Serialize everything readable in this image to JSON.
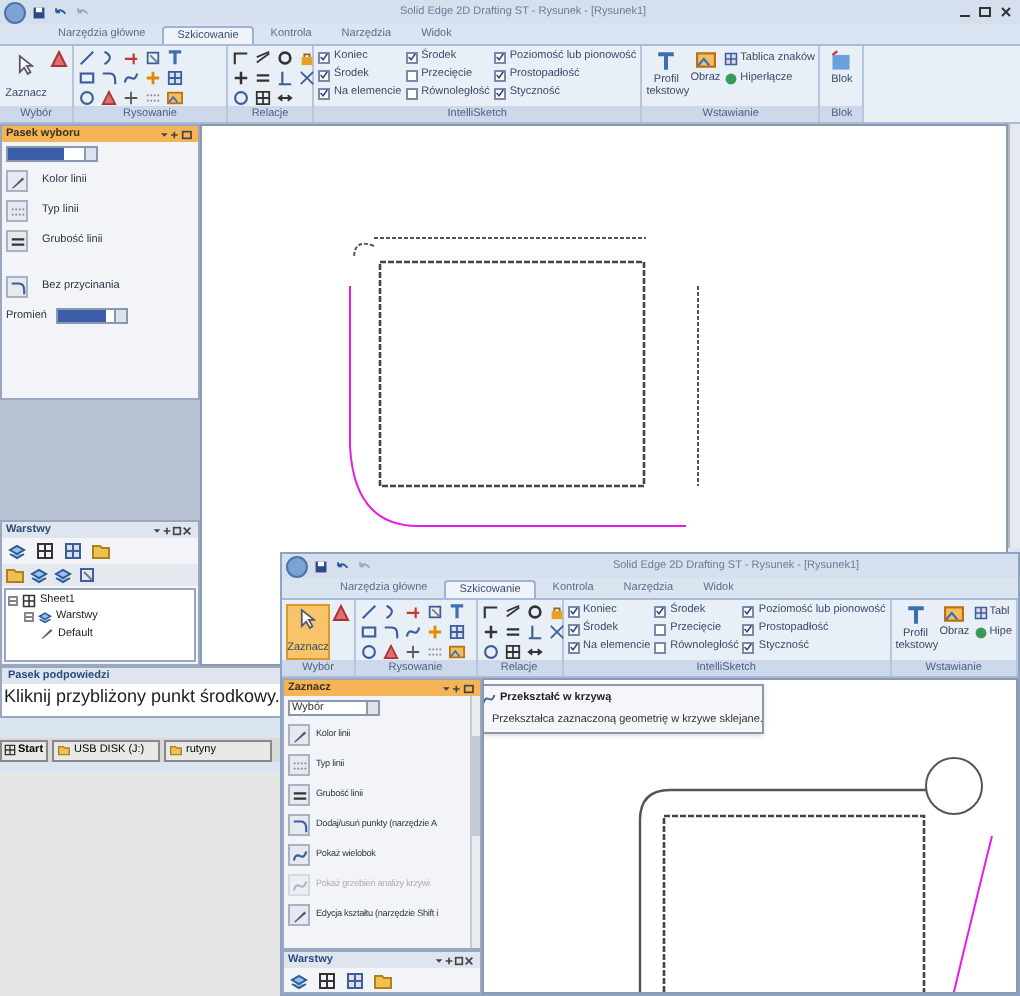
{
  "windows": [
    {
      "title": "Solid Edge 2D Drafting ST - Rysunek - [Rysunek1]",
      "tabs": [
        {
          "label": "Narzędzia główne",
          "selected": false
        },
        {
          "label": "Szkicowanie",
          "selected": true
        },
        {
          "label": "Kontrola",
          "selected": false
        },
        {
          "label": "Narzędzia",
          "selected": false
        },
        {
          "label": "Widok",
          "selected": false
        }
      ],
      "select_tool": {
        "label": "Zaznacz",
        "active": false
      },
      "group_labels": [
        "Wybór",
        "Rysowanie",
        "Relacje",
        "IntelliSketch",
        "Wstawianie",
        "Blok"
      ],
      "intellisketch": [
        {
          "label": "Koniec",
          "checked": true
        },
        {
          "label": "Środek",
          "checked": true
        },
        {
          "label": "Na elemencie",
          "checked": true
        },
        {
          "label": "Środek",
          "checked": true
        },
        {
          "label": "Przecięcie",
          "checked": false
        },
        {
          "label": "Równoległość",
          "checked": false
        },
        {
          "label": "Poziomość lub pionowość",
          "checked": true
        },
        {
          "label": "Prostopadłość",
          "checked": true
        },
        {
          "label": "Styczność",
          "checked": true
        }
      ],
      "insert_tools": [
        "Profil tekstowy",
        "Obraz",
        "Tablica znaków",
        "Hiperłącze"
      ],
      "block_tool": "Blok",
      "panel": {
        "title": "Pasek wyboru",
        "items": [
          {
            "label": "Kolor linii",
            "disabled": false
          },
          {
            "label": "Typ linii",
            "disabled": false
          },
          {
            "label": "Grubość linii",
            "disabled": false
          },
          {
            "label": "Bez przycinania",
            "disabled": false
          }
        ],
        "field_label": "Promień"
      },
      "layers_panel": {
        "title": "Warstwy",
        "tree": [
          {
            "label": "Sheet1",
            "expanded": true,
            "children": [
              {
                "label": "Warstwy",
                "expanded": true,
                "children": [
                  {
                    "label": "Default"
                  }
                ]
              }
            ]
          }
        ]
      },
      "hint_bar": {
        "title": "Pasek podpowiedzi",
        "text": "Kliknij przybliżony punkt środkowy."
      },
      "taskbar": {
        "start": "Start",
        "items": [
          "USB DISK (J:)",
          "rutyny"
        ]
      }
    },
    {
      "title": "Solid Edge 2D Drafting ST - Rysunek - [Rysunek1]",
      "tabs": [
        {
          "label": "Narzędzia główne",
          "selected": false
        },
        {
          "label": "Szkicowanie",
          "selected": true
        },
        {
          "label": "Kontrola",
          "selected": false
        },
        {
          "label": "Narzędzia",
          "selected": false
        },
        {
          "label": "Widok",
          "selected": false
        }
      ],
      "select_tool": {
        "label": "Zaznacz",
        "active": true
      },
      "group_labels": [
        "Wybór",
        "Rysowanie",
        "Relacje",
        "IntelliSketch",
        "Wstawianie"
      ],
      "intellisketch": [
        {
          "label": "Koniec",
          "checked": true
        },
        {
          "label": "Środek",
          "checked": true
        },
        {
          "label": "Na elemencie",
          "checked": true
        },
        {
          "label": "Środek",
          "checked": true
        },
        {
          "label": "Przecięcie",
          "checked": false
        },
        {
          "label": "Równoległość",
          "checked": false
        },
        {
          "label": "Poziomość lub pionowość",
          "checked": true
        },
        {
          "label": "Prostopadłość",
          "checked": true
        },
        {
          "label": "Styczność",
          "checked": true
        }
      ],
      "insert_tools": [
        "Profil tekstowy",
        "Obraz",
        "Tabl",
        "Hipe"
      ],
      "panel": {
        "title": "Zaznacz",
        "dropdown": "Wybór",
        "items": [
          {
            "label": "Kolor linii",
            "disabled": false
          },
          {
            "label": "Typ linii",
            "disabled": false
          },
          {
            "label": "Grubość linii",
            "disabled": false
          },
          {
            "label": "Dodaj/usuń punkty (narzędzie A",
            "disabled": false
          },
          {
            "label": "Pokaż wielobok",
            "disabled": false
          },
          {
            "label": "Pokaż grzebień analizy krzywi",
            "disabled": true
          },
          {
            "label": "Edycja kształtu (narzędzie Shift i",
            "disabled": false
          }
        ]
      },
      "layers_panel": {
        "title": "Warstwy"
      },
      "tooltip": {
        "title": "Przekształć w krzywą",
        "text": "Przekształca zaznaczoną geometrię w krzywe sklejane."
      }
    }
  ]
}
